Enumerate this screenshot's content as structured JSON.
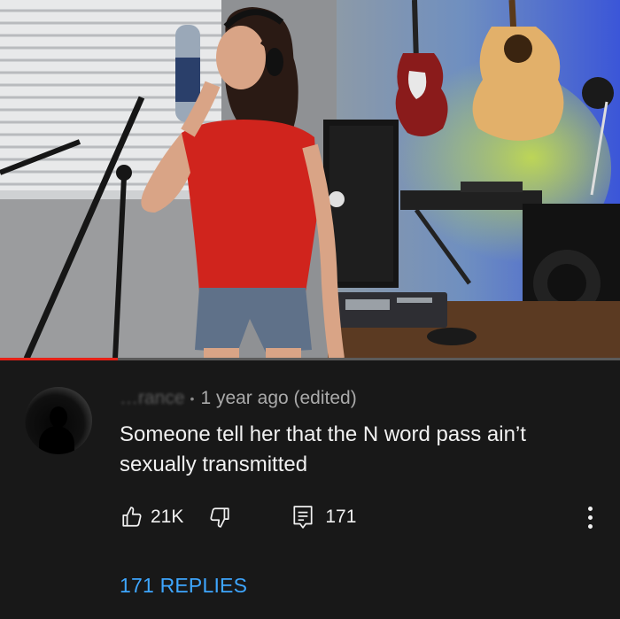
{
  "video": {
    "thumbnail_alt": "",
    "progress": 0.19
  },
  "comment": {
    "author": "…rance",
    "separator": "•",
    "meta": "1 year ago (edited)",
    "text": "Someone tell her that the N word pass ain’t sexually transmitted",
    "likes": "21K",
    "replies_count": "171",
    "replies_link": "171 REPLIES"
  },
  "icons": {
    "like": "thumb-up-icon",
    "dislike": "thumb-down-icon",
    "reply": "comment-icon",
    "more": "more-vert-icon"
  },
  "colors": {
    "background": "#181818",
    "text": "#f1f1f1",
    "muted": "#aaaaaa",
    "link": "#3ea6ff",
    "progress": "#e62117"
  }
}
